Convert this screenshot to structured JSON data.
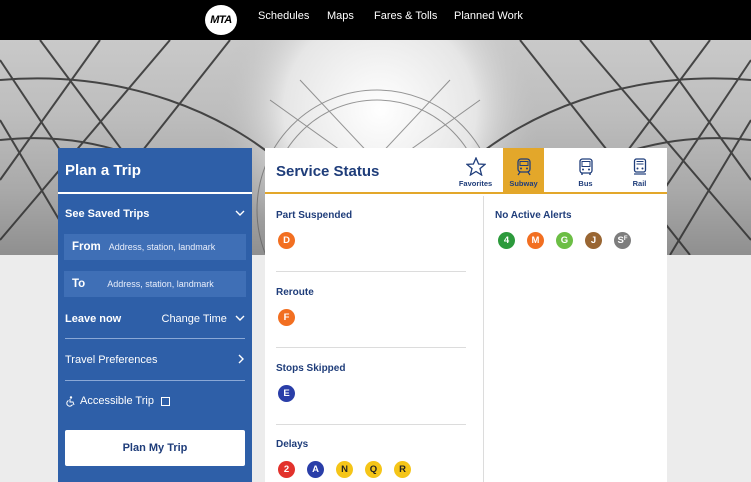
{
  "nav": {
    "logo": "MTA",
    "links": [
      "Schedules",
      "Maps",
      "Fares & Tolls",
      "Planned Work"
    ]
  },
  "plan": {
    "title": "Plan a Trip",
    "saved_trips": "See Saved Trips",
    "from_label": "From",
    "from_placeholder": "Address, station, landmark",
    "to_label": "To",
    "to_placeholder": "Address, station, landmark",
    "leave_now": "Leave now",
    "change_time": "Change Time",
    "travel_preferences": "Travel Preferences",
    "accessible_trip": "Accessible Trip",
    "plan_button": "Plan My Trip"
  },
  "status": {
    "title": "Service Status",
    "tabs": [
      {
        "label": "Favorites",
        "icon": "star-icon",
        "active": false
      },
      {
        "label": "Subway",
        "icon": "subway-icon",
        "active": true
      },
      {
        "label": "Bus",
        "icon": "bus-icon",
        "active": false
      },
      {
        "label": "Rail",
        "icon": "rail-icon",
        "active": false
      }
    ],
    "sections": [
      {
        "title": "Part Suspended",
        "lines": [
          {
            "name": "D",
            "color": "#f26f21"
          }
        ]
      },
      {
        "title": "Reroute",
        "lines": [
          {
            "name": "F",
            "color": "#f26f21"
          }
        ]
      },
      {
        "title": "Stops Skipped",
        "lines": [
          {
            "name": "E",
            "color": "#2a3ea8"
          }
        ]
      },
      {
        "title": "Delays",
        "lines": [
          {
            "name": "2",
            "color": "#e2322c"
          },
          {
            "name": "A",
            "color": "#2a3ea8"
          },
          {
            "name": "N",
            "color": "#f5c518"
          },
          {
            "name": "Q",
            "color": "#f5c518"
          },
          {
            "name": "R",
            "color": "#f5c518"
          }
        ]
      }
    ],
    "no_alerts": {
      "title": "No Active Alerts",
      "lines": [
        {
          "name": "4",
          "color": "#2c9a3c"
        },
        {
          "name": "M",
          "color": "#f26f21"
        },
        {
          "name": "G",
          "color": "#6cbe45"
        },
        {
          "name": "J",
          "color": "#996633"
        },
        {
          "name": "S",
          "sup": "F",
          "color": "#7d7d7d"
        }
      ]
    }
  },
  "colors": {
    "plan_panel": "#2e5fa8",
    "accent": "#e3a72a",
    "heading": "#1f3d7a"
  }
}
